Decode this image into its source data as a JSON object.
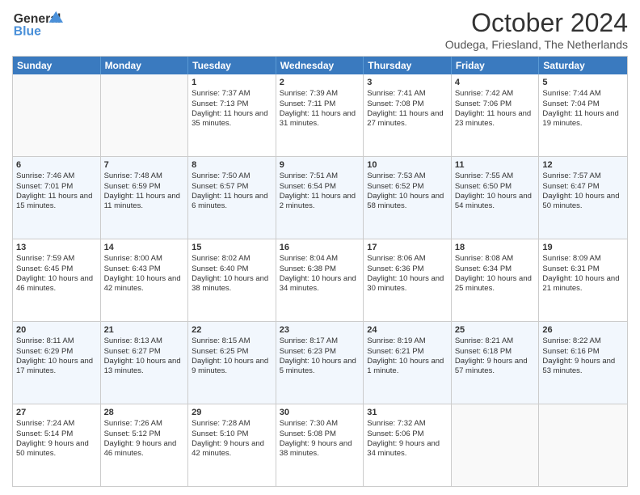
{
  "header": {
    "logo_line1": "General",
    "logo_line2": "Blue",
    "month_title": "October 2024",
    "location": "Oudega, Friesland, The Netherlands"
  },
  "days_of_week": [
    "Sunday",
    "Monday",
    "Tuesday",
    "Wednesday",
    "Thursday",
    "Friday",
    "Saturday"
  ],
  "weeks": [
    [
      {
        "day": "",
        "sunrise": "",
        "sunset": "",
        "daylight": "",
        "empty": true
      },
      {
        "day": "",
        "sunrise": "",
        "sunset": "",
        "daylight": "",
        "empty": true
      },
      {
        "day": "1",
        "sunrise": "Sunrise: 7:37 AM",
        "sunset": "Sunset: 7:13 PM",
        "daylight": "Daylight: 11 hours and 35 minutes."
      },
      {
        "day": "2",
        "sunrise": "Sunrise: 7:39 AM",
        "sunset": "Sunset: 7:11 PM",
        "daylight": "Daylight: 11 hours and 31 minutes."
      },
      {
        "day": "3",
        "sunrise": "Sunrise: 7:41 AM",
        "sunset": "Sunset: 7:08 PM",
        "daylight": "Daylight: 11 hours and 27 minutes."
      },
      {
        "day": "4",
        "sunrise": "Sunrise: 7:42 AM",
        "sunset": "Sunset: 7:06 PM",
        "daylight": "Daylight: 11 hours and 23 minutes."
      },
      {
        "day": "5",
        "sunrise": "Sunrise: 7:44 AM",
        "sunset": "Sunset: 7:04 PM",
        "daylight": "Daylight: 11 hours and 19 minutes."
      }
    ],
    [
      {
        "day": "6",
        "sunrise": "Sunrise: 7:46 AM",
        "sunset": "Sunset: 7:01 PM",
        "daylight": "Daylight: 11 hours and 15 minutes."
      },
      {
        "day": "7",
        "sunrise": "Sunrise: 7:48 AM",
        "sunset": "Sunset: 6:59 PM",
        "daylight": "Daylight: 11 hours and 11 minutes."
      },
      {
        "day": "8",
        "sunrise": "Sunrise: 7:50 AM",
        "sunset": "Sunset: 6:57 PM",
        "daylight": "Daylight: 11 hours and 6 minutes."
      },
      {
        "day": "9",
        "sunrise": "Sunrise: 7:51 AM",
        "sunset": "Sunset: 6:54 PM",
        "daylight": "Daylight: 11 hours and 2 minutes."
      },
      {
        "day": "10",
        "sunrise": "Sunrise: 7:53 AM",
        "sunset": "Sunset: 6:52 PM",
        "daylight": "Daylight: 10 hours and 58 minutes."
      },
      {
        "day": "11",
        "sunrise": "Sunrise: 7:55 AM",
        "sunset": "Sunset: 6:50 PM",
        "daylight": "Daylight: 10 hours and 54 minutes."
      },
      {
        "day": "12",
        "sunrise": "Sunrise: 7:57 AM",
        "sunset": "Sunset: 6:47 PM",
        "daylight": "Daylight: 10 hours and 50 minutes."
      }
    ],
    [
      {
        "day": "13",
        "sunrise": "Sunrise: 7:59 AM",
        "sunset": "Sunset: 6:45 PM",
        "daylight": "Daylight: 10 hours and 46 minutes."
      },
      {
        "day": "14",
        "sunrise": "Sunrise: 8:00 AM",
        "sunset": "Sunset: 6:43 PM",
        "daylight": "Daylight: 10 hours and 42 minutes."
      },
      {
        "day": "15",
        "sunrise": "Sunrise: 8:02 AM",
        "sunset": "Sunset: 6:40 PM",
        "daylight": "Daylight: 10 hours and 38 minutes."
      },
      {
        "day": "16",
        "sunrise": "Sunrise: 8:04 AM",
        "sunset": "Sunset: 6:38 PM",
        "daylight": "Daylight: 10 hours and 34 minutes."
      },
      {
        "day": "17",
        "sunrise": "Sunrise: 8:06 AM",
        "sunset": "Sunset: 6:36 PM",
        "daylight": "Daylight: 10 hours and 30 minutes."
      },
      {
        "day": "18",
        "sunrise": "Sunrise: 8:08 AM",
        "sunset": "Sunset: 6:34 PM",
        "daylight": "Daylight: 10 hours and 25 minutes."
      },
      {
        "day": "19",
        "sunrise": "Sunrise: 8:09 AM",
        "sunset": "Sunset: 6:31 PM",
        "daylight": "Daylight: 10 hours and 21 minutes."
      }
    ],
    [
      {
        "day": "20",
        "sunrise": "Sunrise: 8:11 AM",
        "sunset": "Sunset: 6:29 PM",
        "daylight": "Daylight: 10 hours and 17 minutes."
      },
      {
        "day": "21",
        "sunrise": "Sunrise: 8:13 AM",
        "sunset": "Sunset: 6:27 PM",
        "daylight": "Daylight: 10 hours and 13 minutes."
      },
      {
        "day": "22",
        "sunrise": "Sunrise: 8:15 AM",
        "sunset": "Sunset: 6:25 PM",
        "daylight": "Daylight: 10 hours and 9 minutes."
      },
      {
        "day": "23",
        "sunrise": "Sunrise: 8:17 AM",
        "sunset": "Sunset: 6:23 PM",
        "daylight": "Daylight: 10 hours and 5 minutes."
      },
      {
        "day": "24",
        "sunrise": "Sunrise: 8:19 AM",
        "sunset": "Sunset: 6:21 PM",
        "daylight": "Daylight: 10 hours and 1 minute."
      },
      {
        "day": "25",
        "sunrise": "Sunrise: 8:21 AM",
        "sunset": "Sunset: 6:18 PM",
        "daylight": "Daylight: 9 hours and 57 minutes."
      },
      {
        "day": "26",
        "sunrise": "Sunrise: 8:22 AM",
        "sunset": "Sunset: 6:16 PM",
        "daylight": "Daylight: 9 hours and 53 minutes."
      }
    ],
    [
      {
        "day": "27",
        "sunrise": "Sunrise: 7:24 AM",
        "sunset": "Sunset: 5:14 PM",
        "daylight": "Daylight: 9 hours and 50 minutes."
      },
      {
        "day": "28",
        "sunrise": "Sunrise: 7:26 AM",
        "sunset": "Sunset: 5:12 PM",
        "daylight": "Daylight: 9 hours and 46 minutes."
      },
      {
        "day": "29",
        "sunrise": "Sunrise: 7:28 AM",
        "sunset": "Sunset: 5:10 PM",
        "daylight": "Daylight: 9 hours and 42 minutes."
      },
      {
        "day": "30",
        "sunrise": "Sunrise: 7:30 AM",
        "sunset": "Sunset: 5:08 PM",
        "daylight": "Daylight: 9 hours and 38 minutes."
      },
      {
        "day": "31",
        "sunrise": "Sunrise: 7:32 AM",
        "sunset": "Sunset: 5:06 PM",
        "daylight": "Daylight: 9 hours and 34 minutes."
      },
      {
        "day": "",
        "sunrise": "",
        "sunset": "",
        "daylight": "",
        "empty": true
      },
      {
        "day": "",
        "sunrise": "",
        "sunset": "",
        "daylight": "",
        "empty": true
      }
    ]
  ]
}
